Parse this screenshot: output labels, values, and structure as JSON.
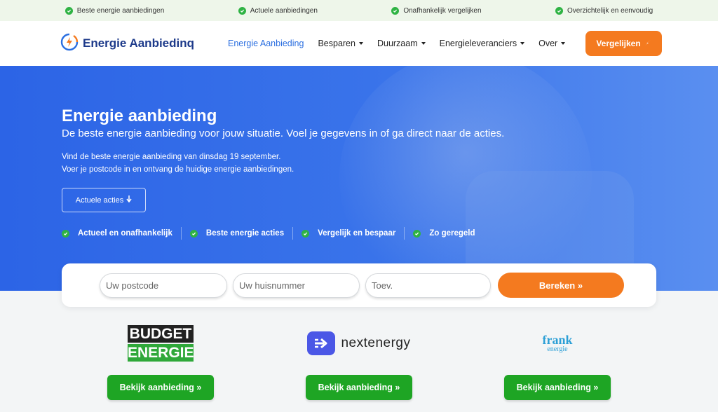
{
  "topbar": {
    "usps": [
      "Beste energie aanbiedingen",
      "Actuele aanbiedingen",
      "Onafhankelijk vergelijken",
      "Overzichtelijk en eenvoudig"
    ]
  },
  "nav": {
    "logo_text": "Energie Aanbiedinq",
    "items": [
      {
        "label": "Energie Aanbieding"
      },
      {
        "label": "Besparen"
      },
      {
        "label": "Duurzaam"
      },
      {
        "label": "Energieleveranciers"
      },
      {
        "label": "Over"
      }
    ],
    "cta_label": "Vergelijken"
  },
  "hero": {
    "title": "Energie aanbieding",
    "subtitle": "De beste energie aanbieding voor jouw situatie. Voel je gegevens in of ga direct naar de acties.",
    "line1": "Vind de beste energie aanbieding van dinsdag 19 september.",
    "line2": "Voer je postcode in en ontvang de huidige energie aanbiedingen.",
    "actions_button": "Actuele acties",
    "usps": [
      "Actueel en onafhankelijk",
      "Beste energie acties",
      "Vergelijk en bespaar",
      "Zo geregeld"
    ]
  },
  "form": {
    "postcode_placeholder": "Uw postcode",
    "huisnummer_placeholder": "Uw huisnummer",
    "toev_placeholder": "Toev.",
    "submit_label": "Bereken »"
  },
  "providers": [
    {
      "logo_line1": "BUDGET",
      "logo_line2": "ENERGIE",
      "button": "Bekijk aanbieding »"
    },
    {
      "logo_text": "nextenergy",
      "button": "Bekijk aanbieding »"
    },
    {
      "logo_line1": "frank",
      "logo_line2": "energie",
      "button": "Bekijk aanbieding »"
    }
  ],
  "colors": {
    "hero_blue": "#2c64e6",
    "accent_orange": "#f47a1f",
    "green": "#1ea524",
    "check_green": "#2fb344",
    "nav_active": "#2a6ee0"
  }
}
